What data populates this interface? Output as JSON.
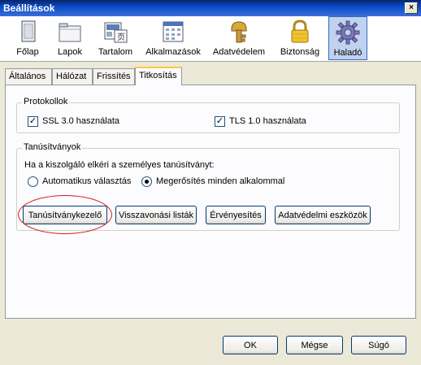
{
  "window": {
    "title": "Beállítások",
    "close_glyph": "×"
  },
  "toolbar": {
    "items": [
      {
        "label": "Főlap",
        "icon": "main-icon"
      },
      {
        "label": "Lapok",
        "icon": "tabs-icon"
      },
      {
        "label": "Tartalom",
        "icon": "content-icon"
      },
      {
        "label": "Alkalmazások",
        "icon": "applications-icon"
      },
      {
        "label": "Adatvédelem",
        "icon": "privacy-icon"
      },
      {
        "label": "Biztonság",
        "icon": "security-lock-icon"
      },
      {
        "label": "Haladó",
        "icon": "advanced-gear-icon",
        "selected": true
      }
    ]
  },
  "tabs": {
    "items": [
      {
        "label": "Általános"
      },
      {
        "label": "Hálózat"
      },
      {
        "label": "Frissítés"
      },
      {
        "label": "Titkosítás",
        "active": true
      }
    ]
  },
  "protocols": {
    "legend": "Protokollok",
    "ssl_label": "SSL 3.0 használata",
    "ssl_checked": true,
    "tls_label": "TLS 1.0 használata",
    "tls_checked": true,
    "check_glyph": "✓"
  },
  "certificates": {
    "legend": "Tanúsítványok",
    "prompt": "Ha a kiszolgáló elkéri a személyes tanúsítványt:",
    "radio_auto_label": "Automatikus választás",
    "radio_auto_selected": false,
    "radio_ask_label": "Megerősítés minden alkalommal",
    "radio_ask_selected": true,
    "buttons": {
      "manager": "Tanúsítványkezelő",
      "revocation": "Visszavonási listák",
      "validation": "Érvényesítés",
      "devices": "Adatvédelmi eszközök"
    },
    "highlight_color": "#d21a1a"
  },
  "footer": {
    "ok": "OK",
    "cancel": "Mégse",
    "help": "Súgó"
  }
}
